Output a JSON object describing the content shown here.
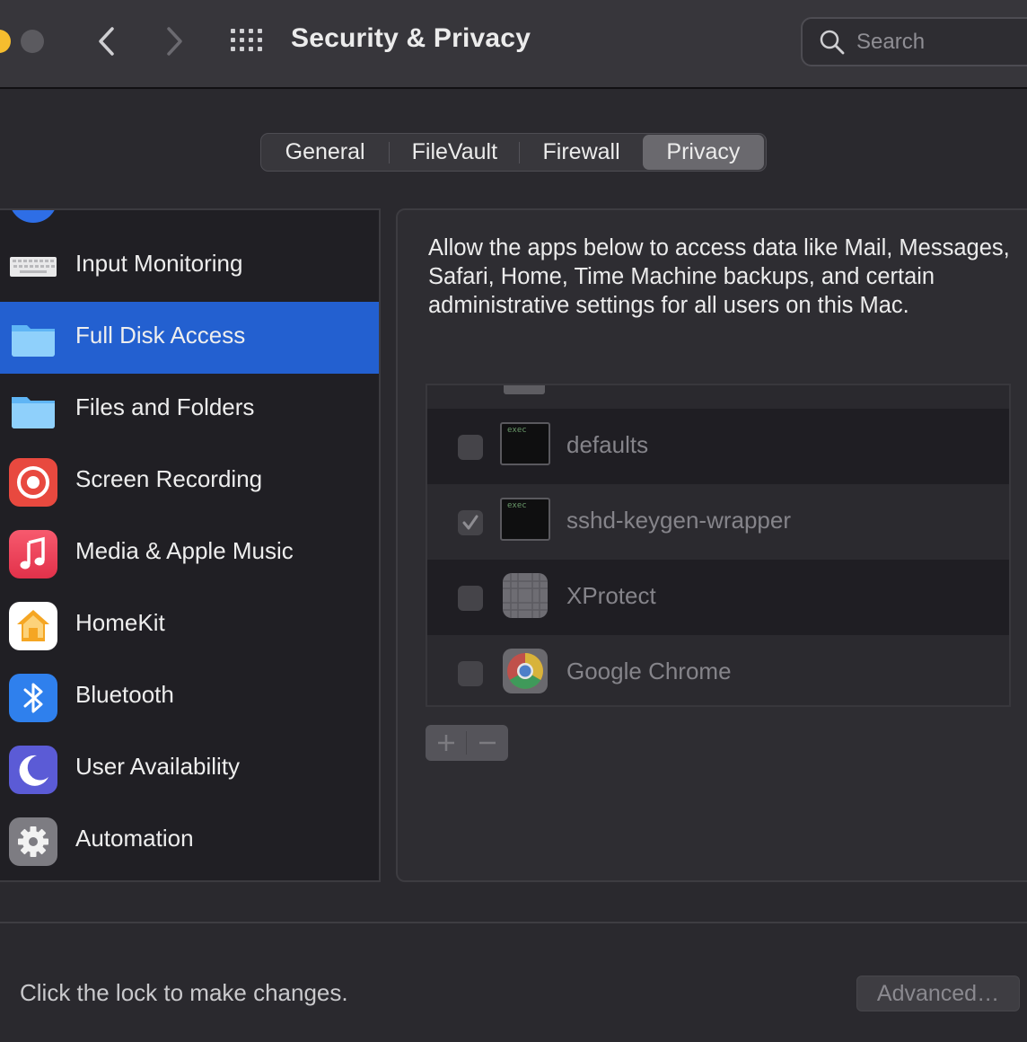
{
  "window": {
    "title": "Security & Privacy",
    "search_placeholder": "Search"
  },
  "tabs": [
    {
      "label": "General",
      "active": false
    },
    {
      "label": "FileVault",
      "active": false
    },
    {
      "label": "Firewall",
      "active": false
    },
    {
      "label": "Privacy",
      "active": true
    }
  ],
  "sidebar": {
    "items": [
      {
        "label": "Input Monitoring",
        "icon": "keyboard-icon",
        "selected": false
      },
      {
        "label": "Full Disk Access",
        "icon": "folder-icon",
        "selected": true
      },
      {
        "label": "Files and Folders",
        "icon": "folder-icon",
        "selected": false
      },
      {
        "label": "Screen Recording",
        "icon": "screen-recording-icon",
        "selected": false
      },
      {
        "label": "Media & Apple Music",
        "icon": "music-note-icon",
        "selected": false
      },
      {
        "label": "HomeKit",
        "icon": "home-icon",
        "selected": false
      },
      {
        "label": "Bluetooth",
        "icon": "bluetooth-icon",
        "selected": false
      },
      {
        "label": "User Availability",
        "icon": "moon-icon",
        "selected": false
      },
      {
        "label": "Automation",
        "icon": "gear-icon",
        "selected": false
      }
    ]
  },
  "panel": {
    "description": "Allow the apps below to access data like Mail, Messages, Safari, Home, Time Machine backups, and certain administrative settings for all users on this Mac.",
    "apps": [
      {
        "name": "defaults",
        "checked": false,
        "icon": "exec-terminal-icon",
        "icon_text": "exec"
      },
      {
        "name": "sshd-keygen-wrapper",
        "checked": true,
        "icon": "exec-terminal-icon",
        "icon_text": "exec"
      },
      {
        "name": "XProtect",
        "checked": false,
        "icon": "xprotect-icon"
      },
      {
        "name": "Google Chrome",
        "checked": false,
        "icon": "chrome-icon"
      }
    ]
  },
  "footer": {
    "lock_text": "Click the lock to make changes.",
    "advanced_label": "Advanced…"
  },
  "colors": {
    "selection": "#2360d0",
    "window_bg": "#2a292e",
    "sidebar_bg": "#201f24"
  }
}
